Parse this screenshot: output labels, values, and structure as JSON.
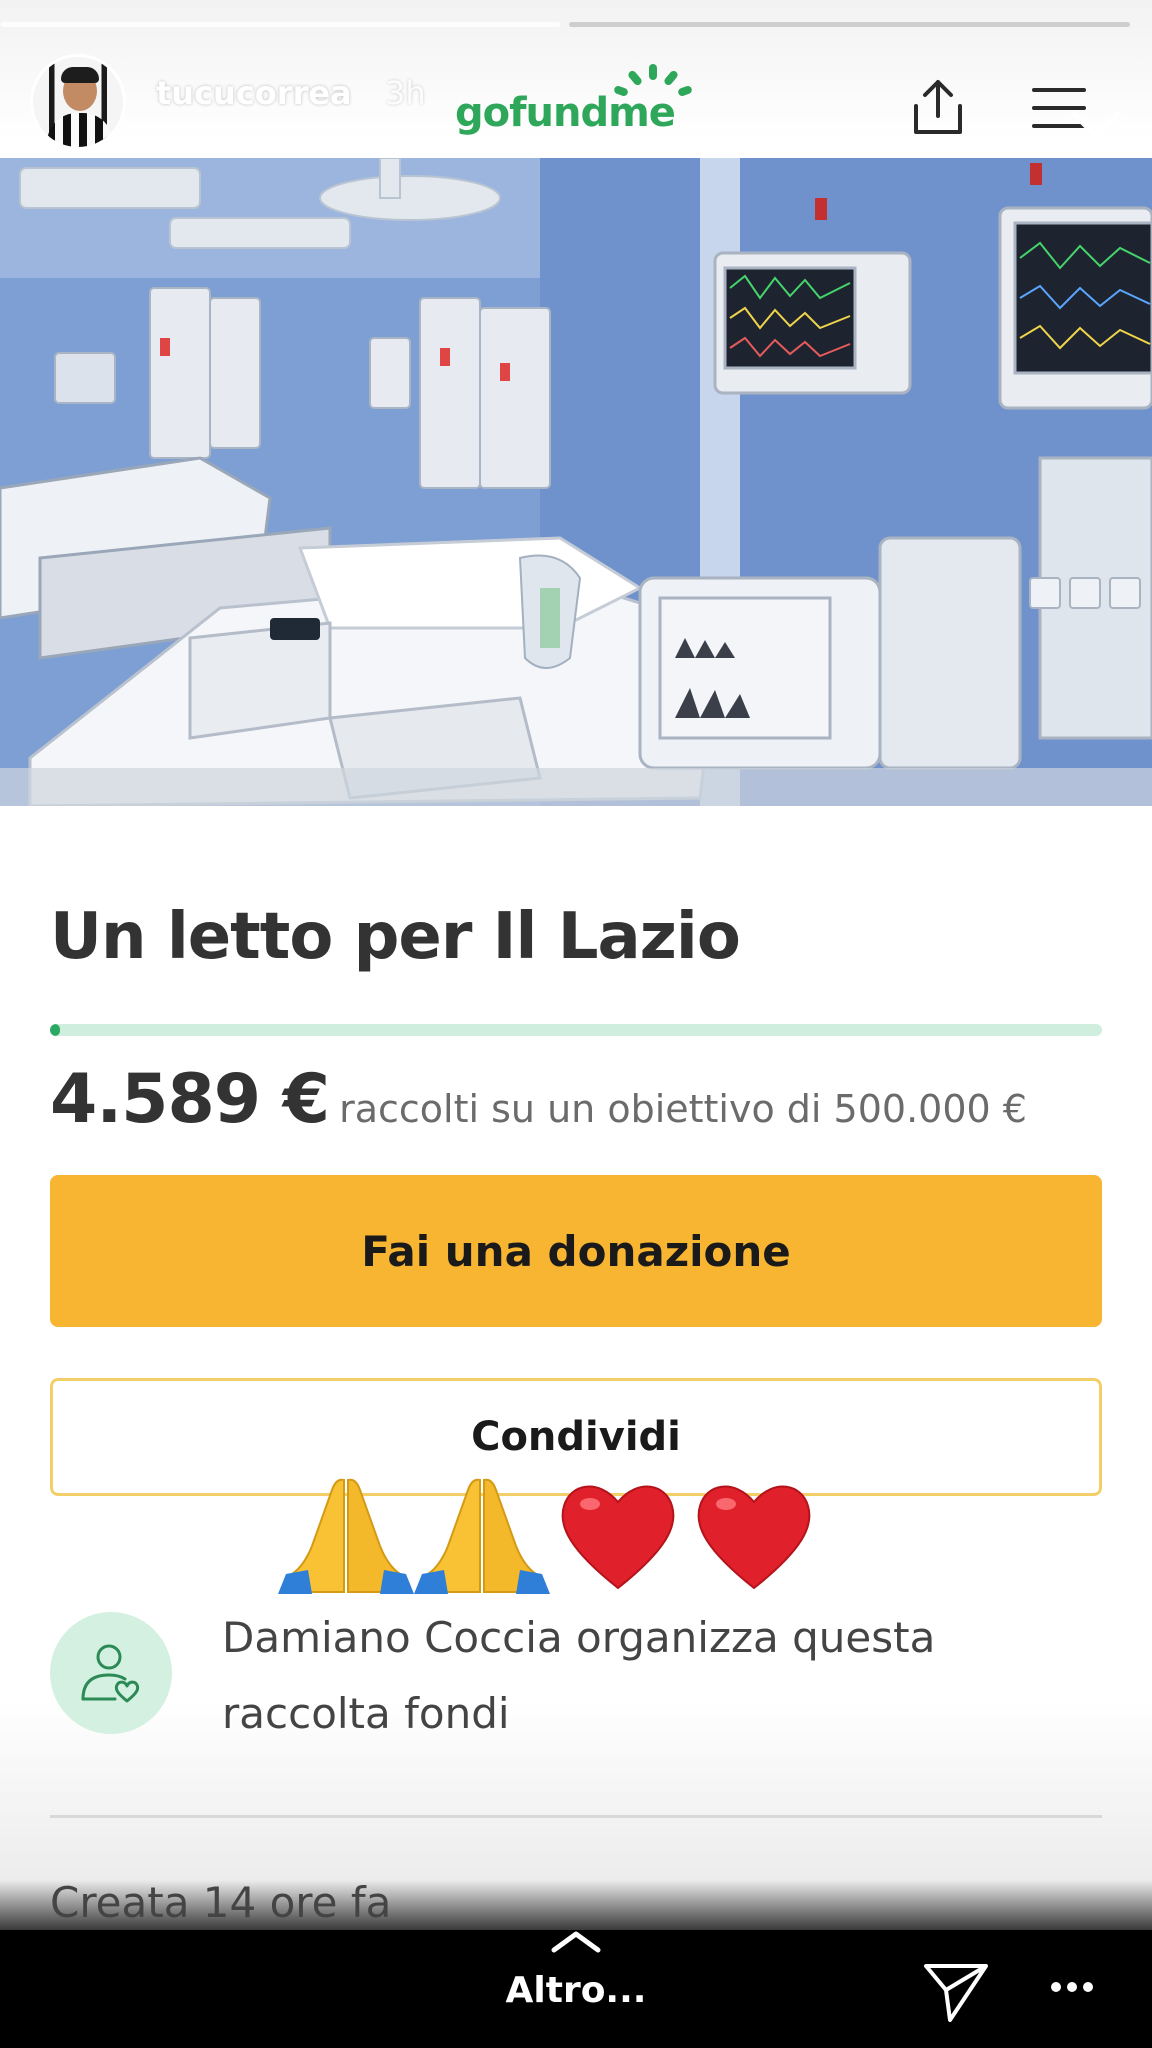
{
  "story": {
    "progress": [
      1.0,
      0.0
    ],
    "username": "tucucorrea",
    "time_ago": "3h",
    "brand_logo": "gofundme"
  },
  "header_icons": [
    "upload-icon",
    "menu-icon",
    "close-icon"
  ],
  "fundraiser": {
    "title": "Un letto per Il Lazio",
    "progress_fraction": 0.0092,
    "raised_amount": "4.589 €",
    "raised_text": "raccolti su un obiettivo di 500.000 €",
    "donate_label": "Fai una donazione",
    "share_label": "Condividi",
    "organizer_text": "Damiano Coccia organizza questa raccolta fondi",
    "created_text": "Creata 14 ore fa"
  },
  "stickers": [
    "folded-hands",
    "folded-hands",
    "red-heart",
    "red-heart"
  ],
  "footer": {
    "more_label": "Altro..."
  },
  "colors": {
    "donate_button": "#f8b531",
    "share_border": "#f3cf6a",
    "progress_fill": "#2ba862",
    "progress_track": "#cfeedd",
    "brand_green": "#2fa75a"
  }
}
